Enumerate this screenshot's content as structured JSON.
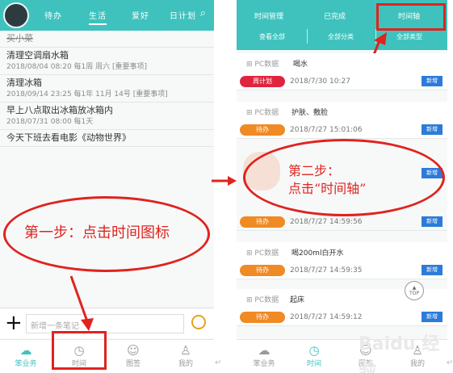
{
  "left": {
    "tabs": [
      "待办",
      "生活",
      "爱好",
      "日计划"
    ],
    "items": [
      {
        "title": "买小菜",
        "strike": true,
        "meta": ""
      },
      {
        "title": "清理空调扇水箱",
        "meta": "2018/08/04 08:20 每1周  周六   [重要事项]"
      },
      {
        "title": "清理冰箱",
        "meta": "2018/09/14 23:25 每1年 11月  14号  [重要事项]"
      },
      {
        "title": "早上八点取出冰箱放冰箱内",
        "meta": "2018/07/31 08:00 每1天"
      },
      {
        "title": "今天下班去看电影《动物世界》",
        "meta": ""
      }
    ],
    "annotation": "第一步：点击时间图标",
    "input_placeholder": "新增一条笔记",
    "nav": [
      "笨业务",
      "时间",
      "图签",
      "我的"
    ]
  },
  "right": {
    "tabs": [
      "时间管理",
      "已完成",
      "时间轴"
    ],
    "sub": [
      "查看全部",
      "全部分类",
      "全部类型"
    ],
    "cards": [
      {
        "source": "PC数据",
        "title": "喝水",
        "badge": "周计划",
        "badge_color": "red",
        "date": "2018/7/30 10:27",
        "btn": "新增"
      },
      {
        "source": "PC数据",
        "title": "护肤、敷脸",
        "badge": "待办",
        "badge_color": "orange",
        "date": "2018/7/27 15:01:06",
        "btn": "新增"
      },
      {
        "source": "",
        "title": "",
        "badge": "待办",
        "badge_color": "orange",
        "date": "2018/7/27 14:59:56",
        "btn": "新增"
      },
      {
        "source": "PC数据",
        "title": "喝200ml白开水",
        "badge": "待办",
        "badge_color": "orange",
        "date": "2018/7/27 14:59:35",
        "btn": "新增"
      },
      {
        "source": "PC数据",
        "title": "起床",
        "badge": "待办",
        "badge_color": "orange",
        "date": "2018/7/27 14:59:12",
        "btn": "新增"
      }
    ],
    "annotation_line1": "第二步：",
    "annotation_line2": "点击“时间轴”",
    "top_label": "TOP",
    "nav": [
      "笨业务",
      "时间",
      "图签",
      "我的"
    ]
  },
  "watermark": "Baidu 经验",
  "colors": {
    "accent": "#3fc2bd",
    "annotation": "#e0231e"
  }
}
